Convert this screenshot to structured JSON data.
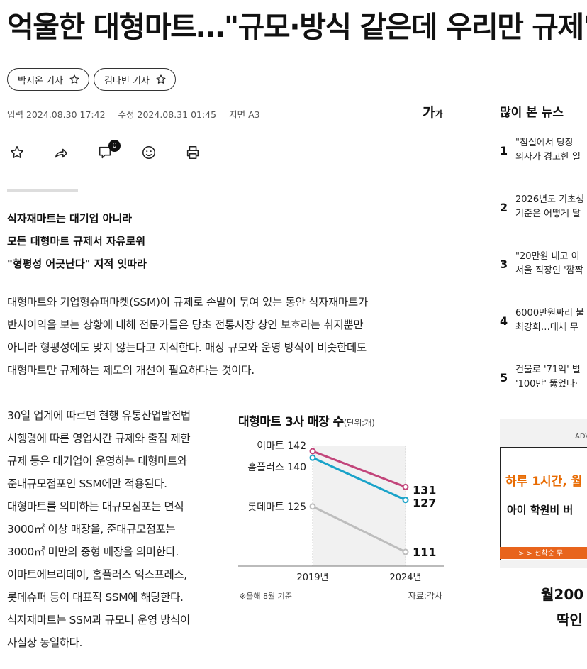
{
  "headline": "억울한 대형마트…\"규모·방식 같은데 우리만 규제\"",
  "reporters": [
    {
      "name": "박시온 기자"
    },
    {
      "name": "김다빈 기자"
    }
  ],
  "meta": {
    "input": "입력 2024.08.30 17:42",
    "modified": "수정 2024.08.31 01:45",
    "page": "지면 A3"
  },
  "font_size_label": "가",
  "font_size_small": "가",
  "comment_count": "0",
  "subheads": [
    "식자재마트는 대기업 아니라",
    "모든 대형마트 규제서 자유로워",
    "\"형평성 어긋난다\" 지적 잇따라"
  ],
  "lead": [
    "대형마트와 기업형슈퍼마켓(SSM)이 규제로 손발이 묶여 있는 동안 식자재마트가",
    "반사이익을 보는 상황에 대해 전문가들은 당초 전통시장 상인 보호라는 취지뿐만",
    "아니라 형평성에도 맞지 않는다고 지적한다. 매장 규모와 운영 방식이 비슷한데도",
    "대형마트만 규제하는 제도의 개선이 필요하다는 것이다."
  ],
  "body2": [
    "30일 업계에 따르면 현행 유통산업발전법",
    "시행령에 따른 영업시간 규제와 출점 제한",
    "규제 등은 대기업이 운영하는 대형마트와",
    "준대규모점포인 SSM에만 적용된다.",
    "대형마트를 의미하는 대규모점포는 면적",
    "3000㎡ 이상 매장을, 준대규모점포는",
    "3000㎡ 미만의 중형 매장을 의미한다.",
    "이마트에브리데이, 홈플러스 익스프레스,",
    "롯데슈퍼 등이 대표적 SSM에 해당한다.",
    "식자재마트는 SSM과 규모나 운영 방식이",
    "사실상 동일하다."
  ],
  "chart_data": {
    "type": "line",
    "title": "대형마트 3사 매장 수",
    "unit": "(단위:개)",
    "x": [
      "2019년",
      "2024년"
    ],
    "series": [
      {
        "name": "이마트",
        "values": [
          142,
          131
        ],
        "color": "#c2457a"
      },
      {
        "name": "홈플러스",
        "values": [
          140,
          127
        ],
        "color": "#1aa3c9"
      },
      {
        "name": "롯데마트",
        "values": [
          125,
          111
        ],
        "color": "#bdbdbd"
      }
    ],
    "footnote": "※올해 8월 기준",
    "source": "자료:각사"
  },
  "sidebar": {
    "title": "많이 본 뉴스",
    "items": [
      {
        "rank": "1",
        "line1": "\"침실에서 당장",
        "line2": "의사가 경고한 일"
      },
      {
        "rank": "2",
        "line1": "2026년도 기초생",
        "line2": "기준은 어떻게 달"
      },
      {
        "rank": "3",
        "line1": "\"20만원 내고 이",
        "line2": "서울 직장인 '깜짝"
      },
      {
        "rank": "4",
        "line1": "6000만원짜리 불",
        "line2": "최강희…대체 무"
      },
      {
        "rank": "5",
        "line1": "건물로 '71억' 벌",
        "line2": "'100만' 뚫었다·"
      }
    ]
  },
  "ad": {
    "label": "ADV",
    "orange": "하루 1시간, 월",
    "black": "아이 학원비 버",
    "strip": ">    >  선착순 무",
    "big1": "월200",
    "big2": "딱인"
  }
}
